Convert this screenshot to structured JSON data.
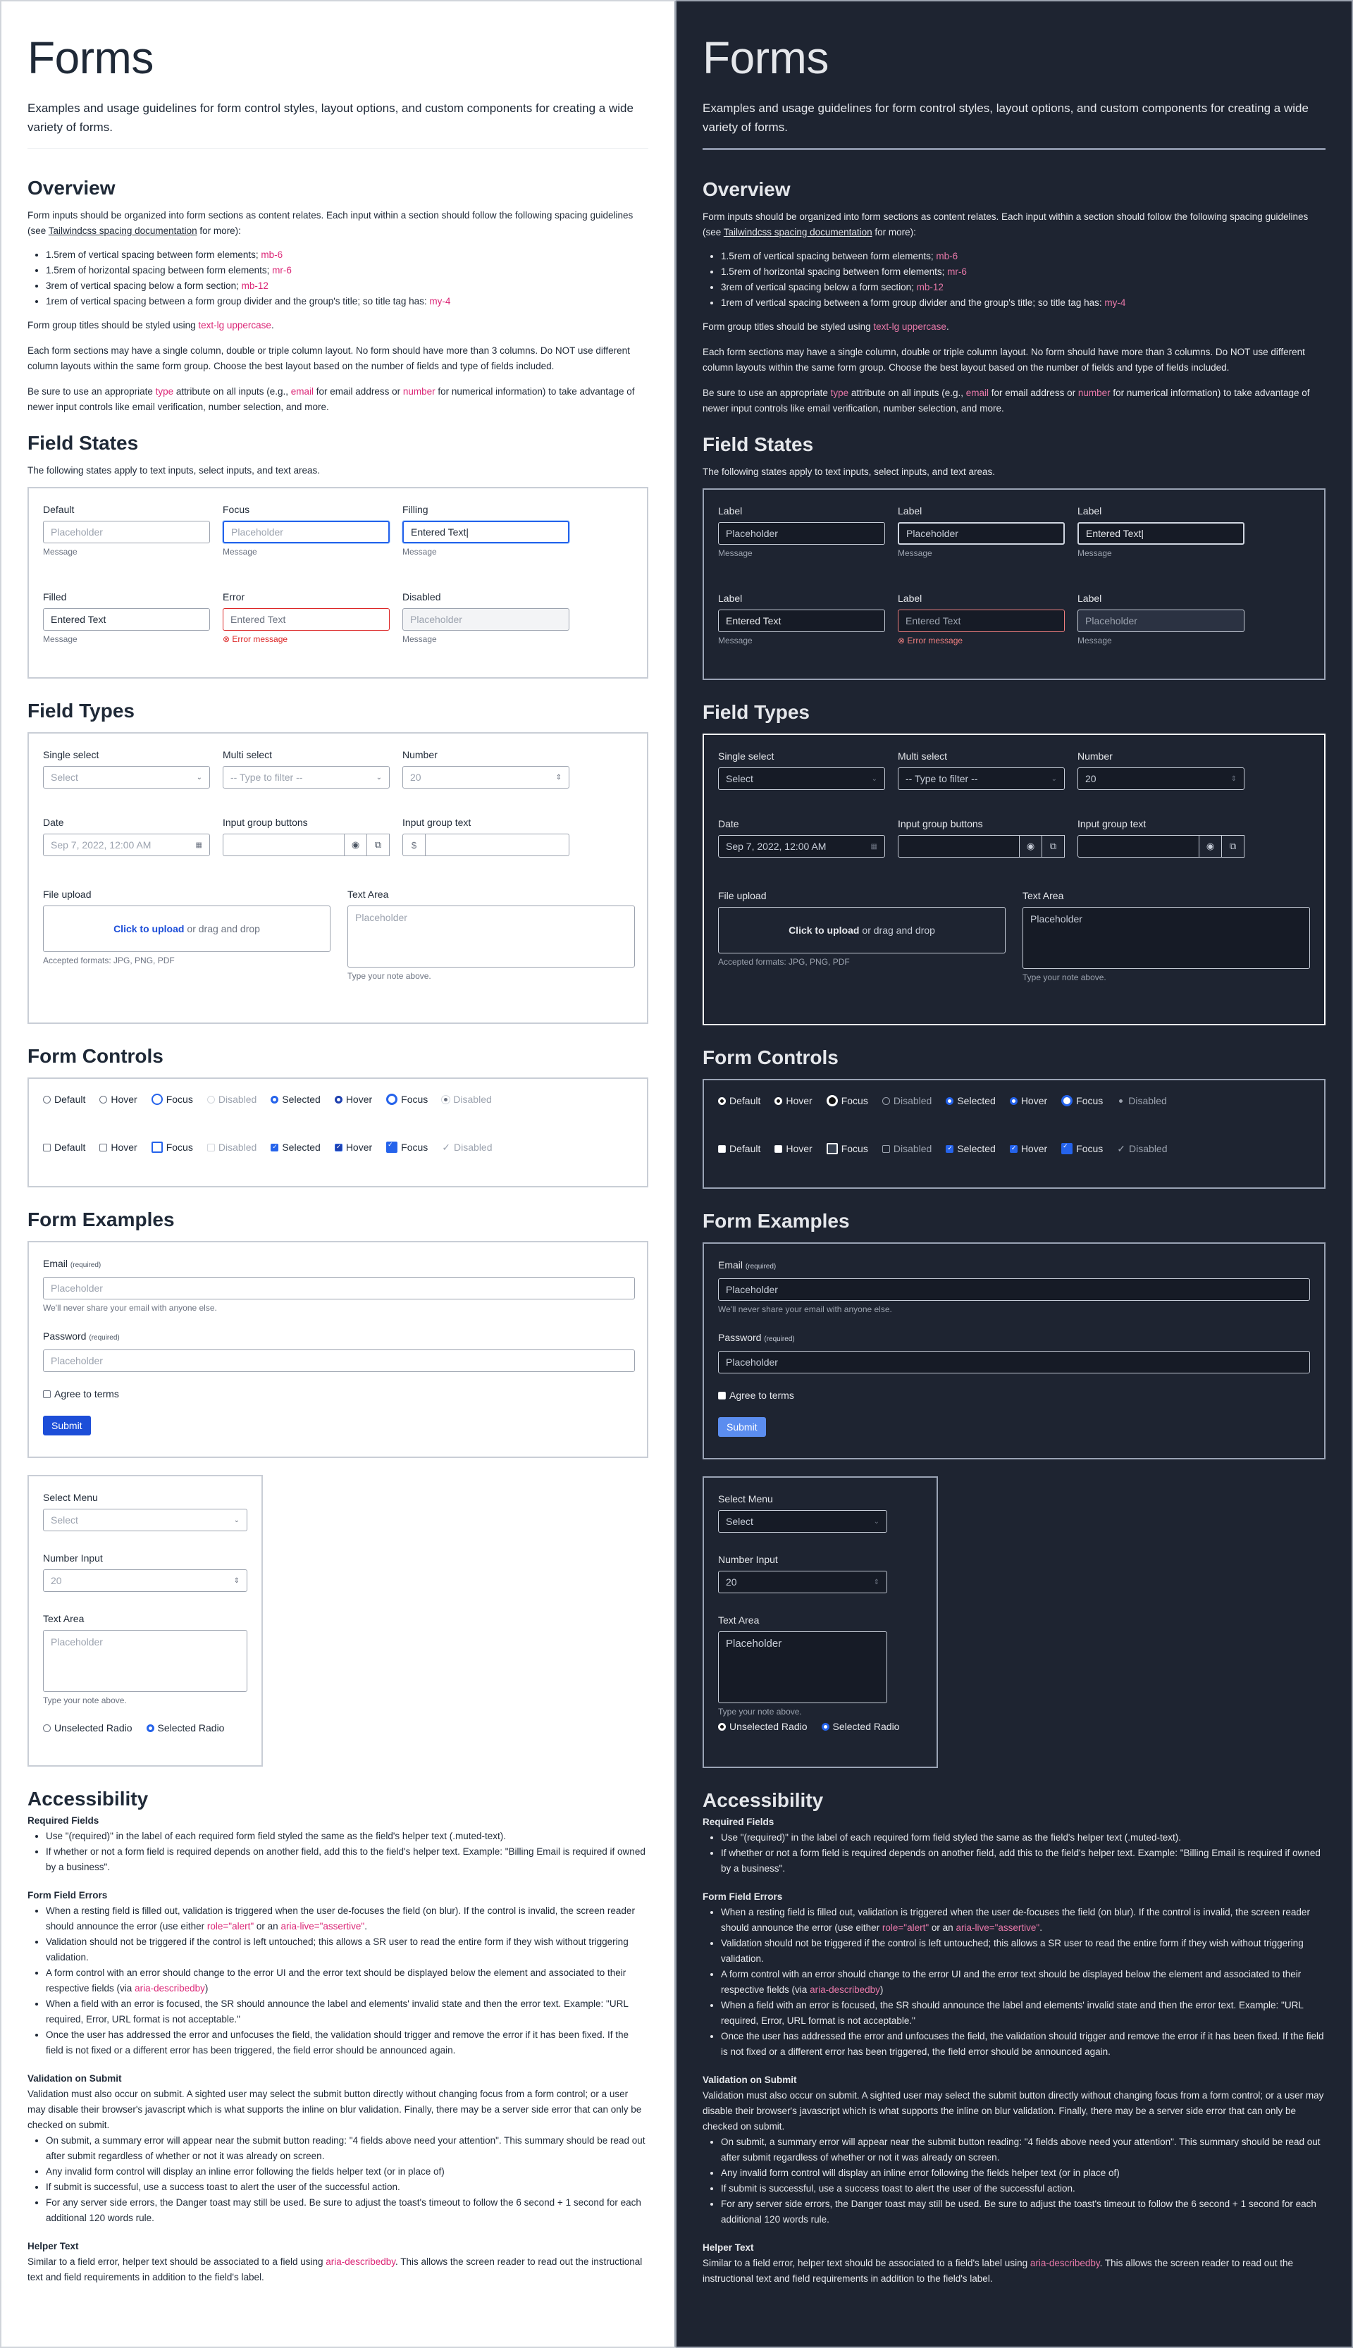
{
  "page": {
    "title": "Forms",
    "lead": "Examples and usage guidelines for form control styles, layout options, and custom components for creating a wide variety of forms."
  },
  "overview": {
    "heading": "Overview",
    "intro_a": "Form inputs should be organized into form sections as content relates.  Each input within a section should follow the following spacing guidelines (see ",
    "intro_link": "Tailwindcss spacing documentation",
    "intro_b": " for more):",
    "bullets": [
      {
        "text": "1.5rem of vertical spacing between form elements; ",
        "code": "mb-6"
      },
      {
        "text": "1.5rem of horizontal spacing between form elements; ",
        "code": "mr-6"
      },
      {
        "text": "3rem of vertical spacing below a form section; ",
        "code": "mb-12"
      },
      {
        "text": "1rem of vertical spacing between a form group divider and the group's title; so title tag has: ",
        "code": "my-4"
      }
    ],
    "titles_a": "Form group titles should be styled using ",
    "titles_code": "text-lg uppercase",
    "titles_b": ".",
    "columns": "Each form sections may have a single column, double or triple column layout. No form should have more than 3 columns. Do NOT use different column layouts within the same form group. Choose the best layout based on the number of fields and type of fields included.",
    "type_a": "Be sure to use an appropriate ",
    "type_code": "type",
    "type_b": " attribute on all inputs (e.g., ",
    "type_email": "email",
    "type_c": " for email address or ",
    "type_number": "number",
    "type_d": " for numerical information) to take advantage of newer input controls like email verification, number selection, and more."
  },
  "field_states": {
    "heading": "Field States",
    "intro": "The following states apply to text inputs, select inputs, and text areas.",
    "light_labels": [
      "Default",
      "Focus",
      "Filling",
      "Filled",
      "Error",
      "Disabled"
    ],
    "dark_label": "Label",
    "placeholder": "Placeholder",
    "entered": "Entered Text",
    "message": "Message",
    "error_message": "Error message"
  },
  "field_types": {
    "heading": "Field Types",
    "single_select": "Single select",
    "single_select_value": "Select",
    "multi_select": "Multi select",
    "multi_select_value": "-- Type to filter --",
    "number": "Number",
    "number_value": "20",
    "date": "Date",
    "date_value": "Sep 7, 2022, 12:00 AM",
    "input_group_buttons": "Input group buttons",
    "input_group_text": "Input group text",
    "input_group_prefix": "$",
    "file_upload": "File upload",
    "upload_link": "Click to upload",
    "upload_rest": "or drag and drop",
    "upload_formats": "Accepted formats: JPG, PNG, PDF",
    "text_area": "Text Area",
    "text_area_placeholder": "Placeholder",
    "text_area_help": "Type your note above."
  },
  "form_controls": {
    "heading": "Form Controls",
    "labels": [
      "Default",
      "Hover",
      "Focus",
      "Disabled",
      "Selected",
      "Hover",
      "Focus",
      "Disabled"
    ]
  },
  "form_examples": {
    "heading": "Form Examples",
    "email_label": "Email",
    "required": "(required)",
    "email_placeholder": "Placeholder",
    "email_help": "We'll never share your email with anyone else.",
    "password_label": "Password",
    "password_placeholder": "Placeholder",
    "agree": "Agree to terms",
    "submit": "Submit",
    "select_menu": "Select Menu",
    "select_value": "Select",
    "number_input": "Number Input",
    "number_value": "20",
    "text_area": "Text Area",
    "text_area_placeholder": "Placeholder",
    "text_area_help": "Type your note above.",
    "unselected_radio": "Unselected Radio",
    "selected_radio": "Selected Radio"
  },
  "accessibility": {
    "heading": "Accessibility",
    "required_fields": "Required Fields",
    "req_1": "Use \"(required)\" in the label of each required form field styled the same as the field's helper text (.muted-text).",
    "req_2": "If whether or not a form field is required depends on another field, add this to the field's helper text. Example: \"Billing Email is required if owned by a business\".",
    "errors_heading": "Form Field Errors",
    "err_1a": "When a resting field is filled out, validation is triggered when the user de-focuses the field (on blur). If the control is invalid, the screen reader should announce the error (use either ",
    "err_1_code1": "role=\"alert\"",
    "err_1b": " or an ",
    "err_1_code2": "aria-live=\"assertive\"",
    "err_1c": ".",
    "err_2": "Validation should not be triggered if the control is left untouched; this allows a SR user to read the entire form if they wish without triggering validation.",
    "err_3a": "A form control with an error should change to the error UI and the error text should be displayed below the element and associated to their respective fields (via ",
    "err_3_code": "aria-describedby",
    "err_3b": ")",
    "err_4": "When a field with an error is focused, the SR should announce the label and elements' invalid state and then the error text. Example: \"URL required, Error, URL format is not acceptable.\"",
    "err_5": "Once the user has addressed the error and unfocuses the field, the validation should trigger and remove the error if it has been fixed. If the field is not fixed or a different error has been triggered, the field error should be announced again.",
    "submit_heading": "Validation on Submit",
    "submit_intro": "Validation must also occur on submit. A sighted user may select the submit button directly without changing focus from a form control; or a user may disable their browser's javascript which is what supports the inline on blur validation. Finally, there may be a server side error that can only be checked on submit.",
    "sub_1": "On submit, a summary error will appear near the submit button reading: \"4 fields above need your attention\". This summary should be read out after submit regardless of whether or not it was already on screen.",
    "sub_2": "Any invalid form control will display an inline error following the fields helper text (or in place of)",
    "sub_3": "If submit is successful, use a success toast to alert the user of the successful action.",
    "sub_4": "For any server side errors, the Danger toast may still be used. Be sure to adjust the toast's timeout to follow the 6 second + 1 second for each additional 120 words rule.",
    "helper_heading": "Helper Text",
    "helper_a": "Similar to a field error, helper text should be associated to a field using ",
    "helper_code": "aria-describedby",
    "helper_a_dark": "Similar to a field error, helper text should be associated to a field's label using ",
    "helper_b": ". This allows the screen reader to read out the instructional text and field requirements in addition to the field's label."
  }
}
